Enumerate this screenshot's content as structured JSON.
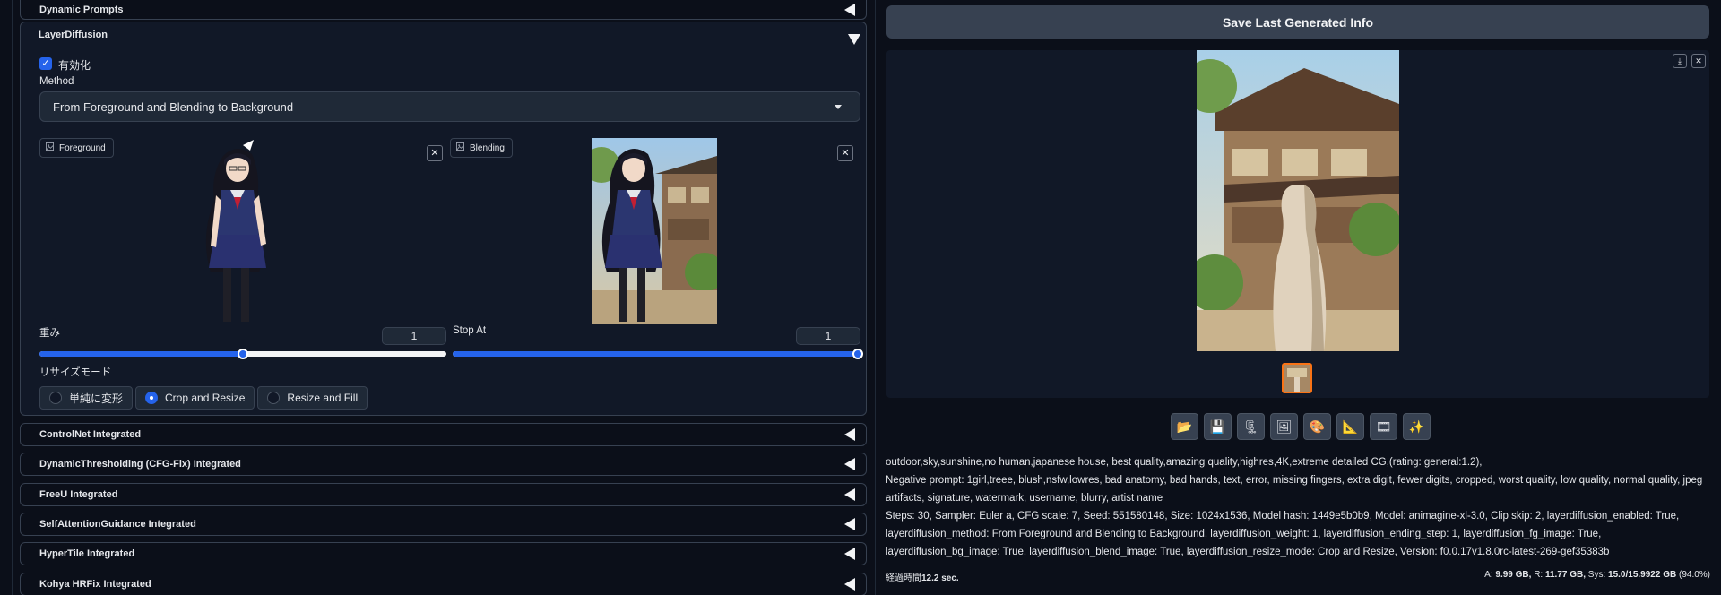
{
  "accordions": {
    "dynamic_prompts": "Dynamic Prompts",
    "layer_diffusion": "LayerDiffusion",
    "controlnet": "ControlNet Integrated",
    "dynamic_thresholding": "DynamicThresholding (CFG-Fix) Integrated",
    "freeu": "FreeU Integrated",
    "self_attention": "SelfAttentionGuidance Integrated",
    "hypertile": "HyperTile Integrated",
    "kohya": "Kohya HRFix Integrated"
  },
  "layer_diffusion": {
    "enable_label": "有効化",
    "enabled": true,
    "method_label": "Method",
    "method_value": "From Foreground and Blending to Background",
    "foreground_label": "Foreground",
    "blending_label": "Blending",
    "weight_label": "重み",
    "weight_value": "1",
    "weight_fraction": 0.5,
    "stop_at_label": "Stop At",
    "stop_at_value": "1",
    "stop_at_fraction": 1.0,
    "resize_mode_label": "リサイズモード",
    "resize_options": [
      "単純に変形",
      "Crop and Resize",
      "Resize and Fill"
    ],
    "resize_selected": "Crop and Resize"
  },
  "output": {
    "save_button": "Save Last Generated Info",
    "tool_icons": [
      "folder-icon",
      "save-icon",
      "zip-icon",
      "image-icon",
      "palette-icon",
      "ruler-icon",
      "video-icon",
      "sparkle-icon"
    ],
    "prompt": "outdoor,sky,sunshine,no human,japanese house, best quality,amazing quality,highres,4K,extreme detailed CG,(rating: general:1.2),",
    "negative_prompt": "Negative prompt: 1girl,treee, blush,nsfw,lowres, bad anatomy, bad hands, text, error, missing fingers, extra digit, fewer digits, cropped, worst quality, low quality, normal quality, jpeg artifacts, signature, watermark, username, blurry, artist name",
    "params": "Steps: 30, Sampler: Euler a, CFG scale: 7, Seed: 551580148, Size: 1024x1536, Model hash: 1449e5b0b9, Model: animagine-xl-3.0, Clip skip: 2, layerdiffusion_enabled: True, layerdiffusion_method: From Foreground and Blending to Background, layerdiffusion_weight: 1, layerdiffusion_ending_step: 1, layerdiffusion_fg_image: True, layerdiffusion_bg_image: True, layerdiffusion_blend_image: True, layerdiffusion_resize_mode: Crop and Resize, Version: f0.0.17v1.8.0rc-latest-269-gef35383b",
    "elapsed_label": "経過時間",
    "elapsed_value": "12.2 sec.",
    "vram_a_label": "A:",
    "vram_a": "9.99 GB,",
    "vram_r_label": "R:",
    "vram_r": "11.77 GB,",
    "vram_sys_label": "Sys:",
    "vram_sys": "15.0/15.9922 GB",
    "vram_pct": "(94.0%)"
  },
  "colors": {
    "accent": "#2563eb",
    "background": "#0b0f19",
    "panel": "#111827",
    "thumb_border": "#f97316"
  }
}
